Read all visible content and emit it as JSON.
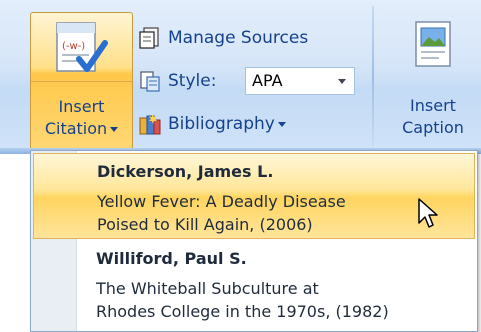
{
  "ribbon": {
    "insert_citation": {
      "line1": "Insert",
      "line2": "Citation"
    },
    "manage_sources": "Manage Sources",
    "style_label": "Style:",
    "style_value": "APA",
    "bibliography": "Bibliography",
    "insert_caption": {
      "line1": "Insert",
      "line2": "Caption"
    }
  },
  "citations": [
    {
      "author": "Dickerson, James L.",
      "title_line1": "Yellow Fever: A Deadly Disease",
      "title_line2": "Poised to Kill Again, (2006)"
    },
    {
      "author": "Williford, Paul S.",
      "title_line1": "The Whiteball Subculture at",
      "title_line2": "Rhodes College in the 1970s, (1982)"
    }
  ],
  "icons": {
    "insert_citation": "citation-checkmark-icon",
    "manage_sources": "manage-sources-icon",
    "style": "style-icon",
    "bibliography": "bibliography-icon",
    "insert_caption": "insert-caption-icon",
    "cursor": "mouse-pointer-icon"
  },
  "colors": {
    "ribbon_text": "#15428b",
    "highlight": "#ffd560"
  }
}
